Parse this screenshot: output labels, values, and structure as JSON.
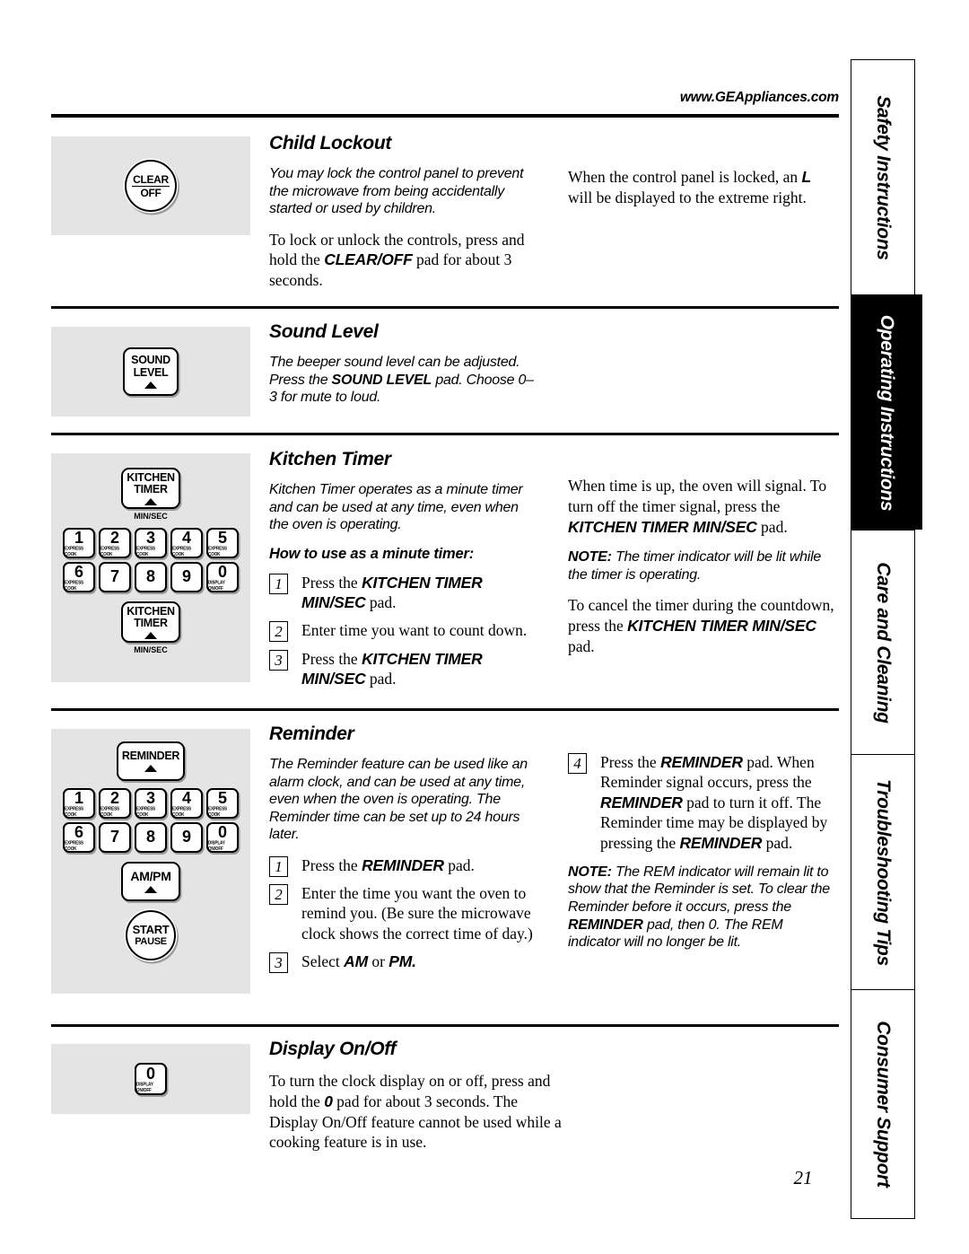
{
  "header": {
    "url": "www.GEAppliances.com"
  },
  "page_number": "21",
  "tabs": [
    {
      "label": "Safety Instructions",
      "active": false
    },
    {
      "label": "Operating Instructions",
      "active": true
    },
    {
      "label": "Care and Cleaning",
      "active": false
    },
    {
      "label": "Troubleshooting Tips",
      "active": false
    },
    {
      "label": "Consumer Support",
      "active": false
    }
  ],
  "keypad": {
    "row1": [
      {
        "digit": "1",
        "sub": "EXPRESS COOK"
      },
      {
        "digit": "2",
        "sub": "EXPRESS COOK"
      },
      {
        "digit": "3",
        "sub": "EXPRESS COOK"
      },
      {
        "digit": "4",
        "sub": "EXPRESS COOK"
      },
      {
        "digit": "5",
        "sub": "EXPRESS COOK"
      }
    ],
    "row2": [
      {
        "digit": "6",
        "sub": "EXPRESS COOK"
      },
      {
        "digit": "7",
        "sub": ""
      },
      {
        "digit": "8",
        "sub": ""
      },
      {
        "digit": "9",
        "sub": ""
      },
      {
        "digit": "0",
        "sub": "DISPLAY ON/OFF"
      }
    ]
  },
  "sections": {
    "child_lockout": {
      "title": "Child Lockout",
      "pad": {
        "line1": "CLEAR",
        "line2": "OFF"
      },
      "left_p1": "You may lock the control panel to prevent the microwave from being accidentally started or used by children.",
      "left_p2_a": "To lock or unlock the controls, press and hold the ",
      "left_p2_b": "CLEAR/OFF",
      "left_p2_c": " pad for about 3 seconds.",
      "right_p1_a": "When the control panel is locked, an ",
      "right_p1_b": "L",
      "right_p1_c": " will be displayed to the extreme right."
    },
    "sound_level": {
      "title": "Sound Level",
      "pad": {
        "line1": "SOUND",
        "line2": "LEVEL"
      },
      "p1_a": "The beeper sound level can be adjusted. Press the ",
      "p1_b": "SOUND LEVEL",
      "p1_c": " pad. Choose 0–3 for mute to loud."
    },
    "kitchen_timer": {
      "title": "Kitchen Timer",
      "pad": {
        "line1": "KITCHEN",
        "line2": "TIMER",
        "caption": "MIN/SEC"
      },
      "p1": "Kitchen Timer operates as a minute timer and can be used at any time, even when the oven is operating.",
      "subhead": "How to use as a minute timer:",
      "steps": [
        {
          "n": "1",
          "a": "Press the ",
          "b": "KITCHEN TIMER MIN/SEC",
          "c": " pad."
        },
        {
          "n": "2",
          "a": "Enter time you want to count down.",
          "b": "",
          "c": ""
        },
        {
          "n": "3",
          "a": "Press the ",
          "b": "KITCHEN TIMER MIN/SEC",
          "c": " pad."
        }
      ],
      "right_p1_a": "When time is up, the oven will signal. To turn off the timer signal, press the ",
      "right_p1_b": "KITCHEN TIMER MIN/SEC",
      "right_p1_c": " pad.",
      "note_label": "NOTE:",
      "note_text": " The timer indicator will be lit while the timer is operating.",
      "right_p2_a": "To cancel the timer during the countdown, press the ",
      "right_p2_b": "KITCHEN TIMER MIN/SEC",
      "right_p2_c": " pad."
    },
    "reminder": {
      "title": "Reminder",
      "pad_reminder": "REMINDER",
      "pad_ampm": "AM/PM",
      "pad_start": {
        "line1": "START",
        "line2": "PAUSE"
      },
      "p1": "The Reminder feature can be used like an alarm clock, and can be used at any time, even when the oven is operating. The Reminder time can be set up to 24 hours later.",
      "steps": [
        {
          "n": "1",
          "a": "Press the ",
          "b": "REMINDER",
          "c": "  pad."
        },
        {
          "n": "2",
          "a": "Enter the time you want the oven to remind you. (Be sure the microwave clock shows the correct time of day.)",
          "b": "",
          "c": ""
        },
        {
          "n": "3",
          "a": "Select ",
          "b": "AM",
          "c": "  or ",
          "d": "PM."
        }
      ],
      "step4": {
        "n": "4",
        "a": "Press the ",
        "b": "REMINDER",
        "c": " pad. When Reminder signal occurs, press the ",
        "d": "REMINDER",
        "e": " pad to turn it off. The Reminder time may be displayed by pressing the ",
        "f": "REMINDER",
        "g": " pad."
      },
      "note_label": "NOTE:",
      "note_a": " The REM indicator will remain lit to show that the Reminder is set. To clear the Reminder before it occurs, press the ",
      "note_b": "REMINDER",
      "note_c": " pad, then 0. The REM indicator will no longer be lit."
    },
    "display_onoff": {
      "title": "Display On/Off",
      "pad": {
        "digit": "0",
        "sub": "DISPLAY ON/OFF"
      },
      "p1_a": "To turn the clock display on or off, press and hold the ",
      "p1_b": "0",
      "p1_c": " pad for about 3 seconds. The Display On/Off feature cannot be used while a cooking feature is in use."
    }
  }
}
